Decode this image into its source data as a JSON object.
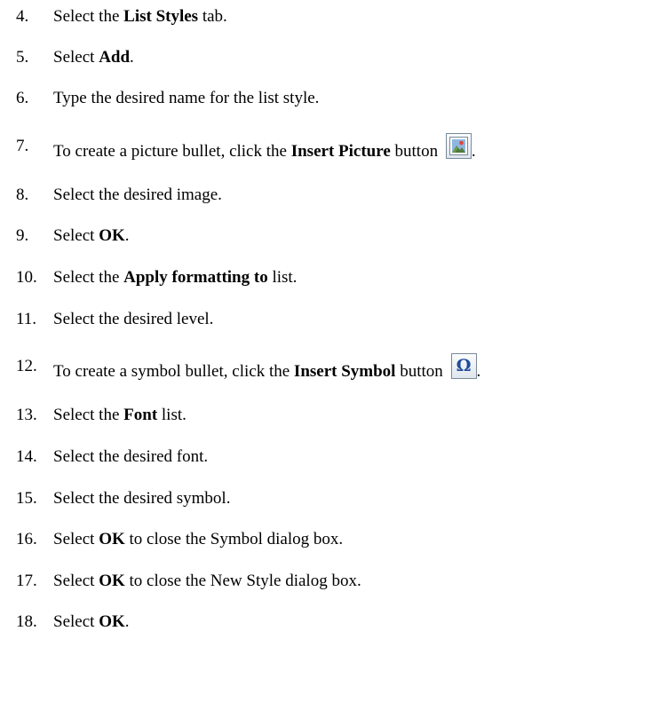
{
  "steps": [
    {
      "number": "4.",
      "parts": [
        {
          "t": "Select the "
        },
        {
          "t": "List Styles",
          "b": true
        },
        {
          "t": " tab."
        }
      ]
    },
    {
      "number": "5.",
      "parts": [
        {
          "t": "Select "
        },
        {
          "t": "Add",
          "b": true
        },
        {
          "t": "."
        }
      ]
    },
    {
      "number": "6.",
      "parts": [
        {
          "t": "Type the desired name for the list style."
        }
      ]
    },
    {
      "number": "7.",
      "parts": [
        {
          "t": "To create a picture bullet, click the "
        },
        {
          "t": "Insert Picture",
          "b": true
        },
        {
          "t": " button "
        },
        {
          "icon": "insert-picture-icon"
        },
        {
          "t": "."
        }
      ]
    },
    {
      "number": "8.",
      "parts": [
        {
          "t": "Select the desired image."
        }
      ]
    },
    {
      "number": "9.",
      "parts": [
        {
          "t": "Select "
        },
        {
          "t": "OK",
          "b": true
        },
        {
          "t": "."
        }
      ]
    },
    {
      "number": "10.",
      "parts": [
        {
          "t": "Select the "
        },
        {
          "t": "Apply formatting to",
          "b": true
        },
        {
          "t": " list."
        }
      ]
    },
    {
      "number": "11.",
      "parts": [
        {
          "t": "Select the desired level."
        }
      ]
    },
    {
      "number": "12.",
      "parts": [
        {
          "t": "To create a symbol bullet, click the "
        },
        {
          "t": "Insert Symbol",
          "b": true
        },
        {
          "t": " button "
        },
        {
          "icon": "insert-symbol-icon"
        },
        {
          "t": "."
        }
      ]
    },
    {
      "number": "13.",
      "parts": [
        {
          "t": "Select the "
        },
        {
          "t": "Font",
          "b": true
        },
        {
          "t": " list."
        }
      ]
    },
    {
      "number": "14.",
      "parts": [
        {
          "t": "Select the desired font."
        }
      ]
    },
    {
      "number": "15.",
      "parts": [
        {
          "t": "Select the desired symbol."
        }
      ]
    },
    {
      "number": "16.",
      "parts": [
        {
          "t": "Select "
        },
        {
          "t": "OK",
          "b": true
        },
        {
          "t": " to close the Symbol dialog box."
        }
      ]
    },
    {
      "number": "17.",
      "parts": [
        {
          "t": "Select "
        },
        {
          "t": "OK",
          "b": true
        },
        {
          "t": " to close the New Style dialog box."
        }
      ]
    },
    {
      "number": "18.",
      "parts": [
        {
          "t": "Select "
        },
        {
          "t": "OK",
          "b": true
        },
        {
          "t": "."
        }
      ]
    }
  ],
  "icons": {
    "insert-symbol-icon": {
      "glyph": "Ω",
      "color": "#1f4e9a"
    },
    "insert-picture-icon": {
      "frame_color": "#7a8a99",
      "sky_color": "#8fb6e0",
      "sun_color": "#e0453a"
    }
  }
}
